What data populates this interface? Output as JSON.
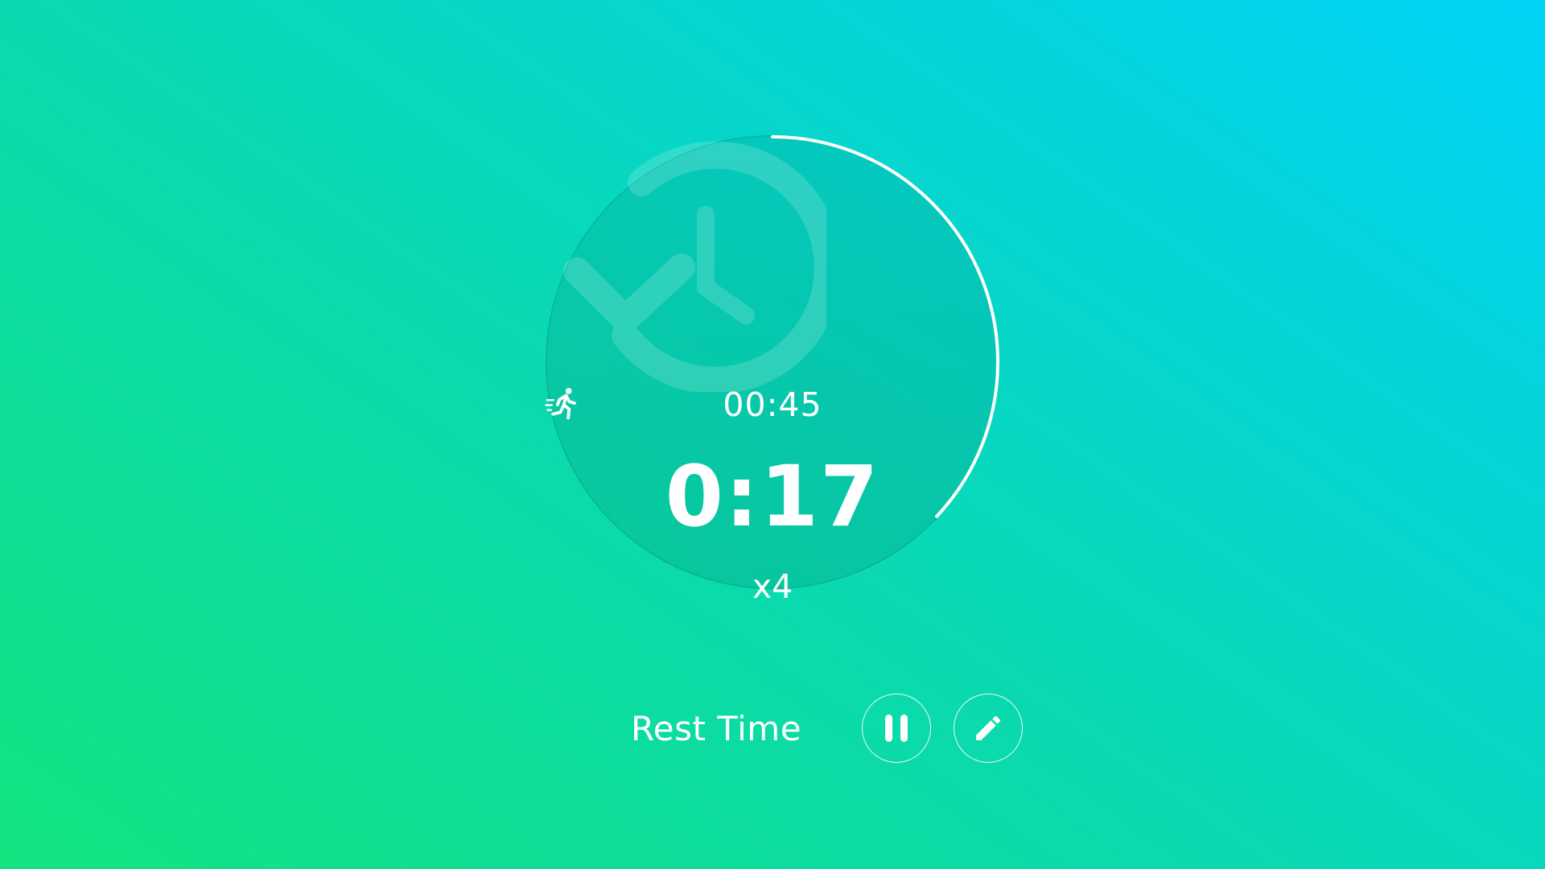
{
  "timer": {
    "interval_time": "00:45",
    "countdown": "0:17",
    "rounds": "x4",
    "progress_remaining": 0.37,
    "interval_icon": "running-person-icon",
    "watermark_icon": "repeat-icon"
  },
  "controls": {
    "phase_label": "Rest Time",
    "pause_icon": "pause-icon",
    "edit_icon": "pencil-icon"
  },
  "colors": {
    "gradient_start": "#12e37f",
    "gradient_end": "#00d4f7",
    "progress_ring": "#ffffff"
  }
}
